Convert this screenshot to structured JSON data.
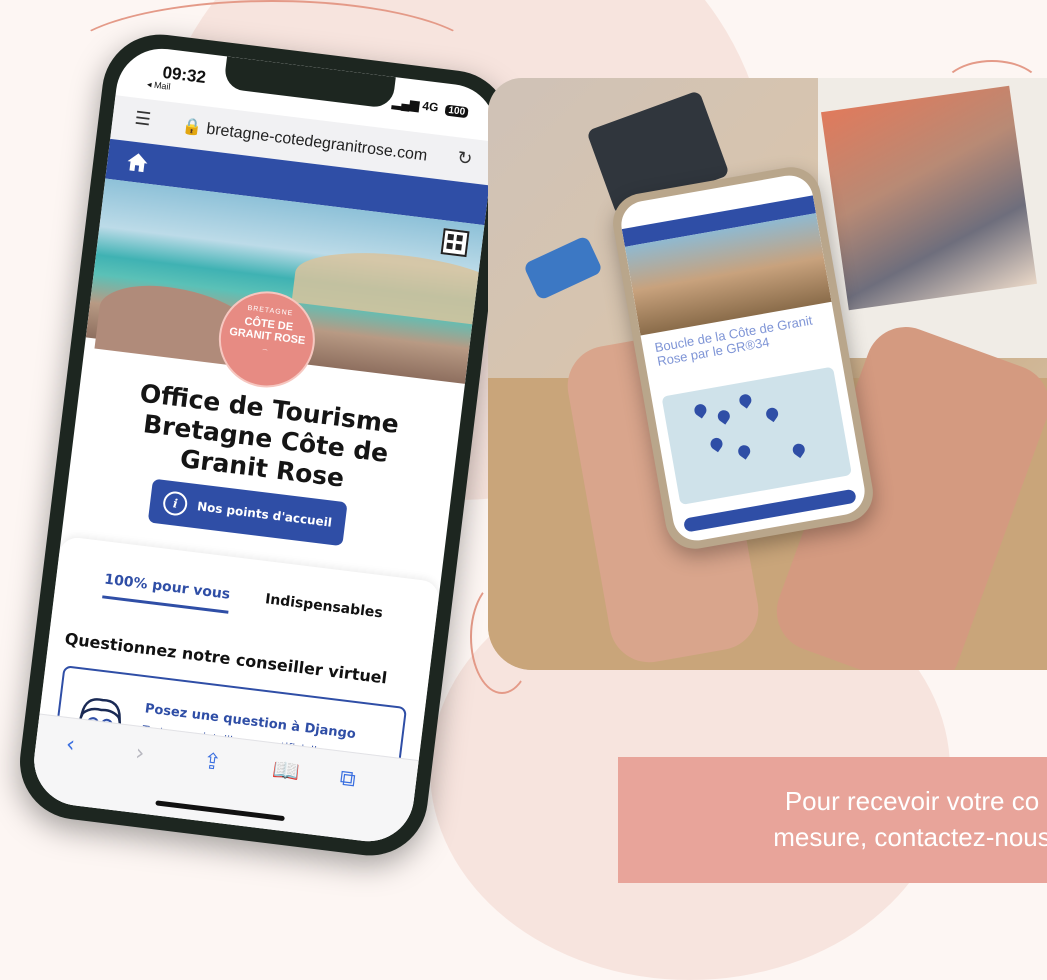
{
  "phone": {
    "status": {
      "time": "09:32",
      "back_app": "◂ Mail",
      "network": "4G",
      "battery": "100"
    },
    "browser": {
      "url": "bretagne-cotedegranitrose.com"
    },
    "logo": {
      "line1": "BRETAGNE",
      "line2": "CÔTE DE GRANIT ROSE"
    },
    "site": {
      "title": "Office de Tourisme Bretagne Côte de Granit Rose",
      "cta_label": "Nos points d'accueil",
      "tabs": [
        {
          "label": "100% pour vous"
        },
        {
          "label": "Indispensables"
        }
      ],
      "section_title": "Questionnez notre conseiller virtuel",
      "card": {
        "title": "Posez une question à Django",
        "subtitle": "Testez son intelligence artificielle"
      }
    },
    "toolbar_icons": [
      "back-icon",
      "forward-icon",
      "share-icon",
      "bookmarks-icon",
      "tabs-icon"
    ]
  },
  "photo": {
    "phone_screen": {
      "title": "Boucle de la Côte de Granit Rose par le GR®34"
    }
  },
  "banner": {
    "line1": "Pour recevoir votre co",
    "line2": "mesure, contactez-nous"
  },
  "colors": {
    "brand_blue": "#2f4ea6",
    "rose": "#e8a49a",
    "logo_pink": "#e78b83"
  }
}
